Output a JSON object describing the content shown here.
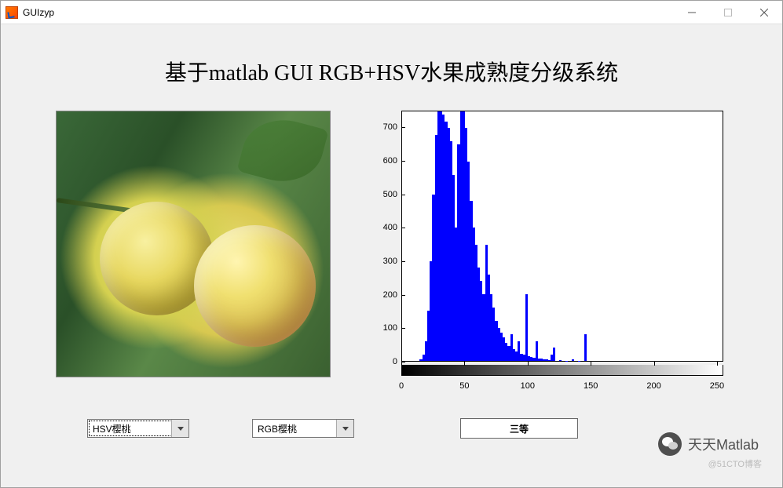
{
  "window": {
    "title": "GUIzyp"
  },
  "page_title": "基于matlab GUI RGB+HSV水果成熟度分级系统",
  "controls": {
    "combo1": {
      "value": "HSV樱桃"
    },
    "combo2": {
      "value": "RGB樱桃"
    },
    "result": "三等"
  },
  "watermark": {
    "main": "天天Matlab",
    "sub": "@51CTO博客"
  },
  "chart_data": {
    "type": "bar",
    "title": "",
    "xlabel": "",
    "ylabel": "",
    "xlim": [
      0,
      255
    ],
    "ylim": [
      0,
      750
    ],
    "x_ticks": [
      0,
      50,
      100,
      150,
      200,
      250
    ],
    "y_ticks": [
      0,
      100,
      200,
      300,
      400,
      500,
      600,
      700
    ],
    "colorbar": "grayscale",
    "series": [
      {
        "name": "histogram",
        "color": "#0000ff",
        "x": [
          0,
          2,
          4,
          6,
          8,
          10,
          12,
          14,
          16,
          18,
          20,
          22,
          24,
          26,
          28,
          30,
          32,
          34,
          36,
          38,
          40,
          42,
          44,
          46,
          48,
          50,
          52,
          54,
          56,
          58,
          60,
          62,
          64,
          66,
          68,
          70,
          72,
          74,
          76,
          78,
          80,
          82,
          84,
          86,
          88,
          90,
          92,
          94,
          96,
          98,
          100,
          102,
          104,
          106,
          108,
          110,
          112,
          114,
          116,
          118,
          120,
          125,
          130,
          135,
          140,
          145,
          150,
          160,
          170,
          180,
          190,
          200,
          210,
          220,
          230,
          240,
          250
        ],
        "y": [
          0,
          0,
          0,
          0,
          0,
          0,
          0,
          5,
          20,
          60,
          150,
          300,
          500,
          680,
          750,
          750,
          740,
          720,
          700,
          660,
          560,
          400,
          650,
          750,
          750,
          700,
          600,
          480,
          400,
          350,
          280,
          240,
          200,
          350,
          260,
          200,
          160,
          120,
          100,
          85,
          70,
          55,
          45,
          80,
          35,
          28,
          60,
          22,
          18,
          200,
          14,
          12,
          10,
          60,
          8,
          6,
          5,
          4,
          3,
          20,
          40,
          2,
          1,
          5,
          1,
          80,
          0,
          0,
          0,
          0,
          0,
          0,
          0,
          0,
          0,
          0,
          0
        ]
      }
    ]
  }
}
